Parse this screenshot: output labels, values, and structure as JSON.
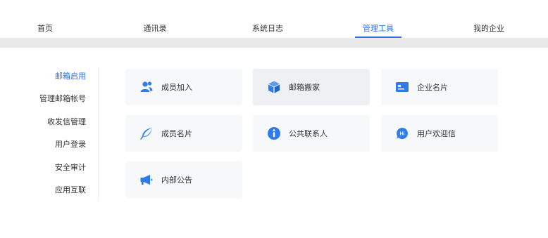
{
  "top_tabs": [
    {
      "label": "首页",
      "active": false
    },
    {
      "label": "通讯录",
      "active": false
    },
    {
      "label": "系统日志",
      "active": false
    },
    {
      "label": "管理工具",
      "active": true
    },
    {
      "label": "我的企业",
      "active": false
    }
  ],
  "side_menu": [
    {
      "label": "邮箱启用",
      "active": true
    },
    {
      "label": "管理邮箱帐号",
      "active": false
    },
    {
      "label": "收发信管理",
      "active": false
    },
    {
      "label": "用户登录",
      "active": false
    },
    {
      "label": "安全审计",
      "active": false
    },
    {
      "label": "应用互联",
      "active": false
    }
  ],
  "tools": [
    {
      "label": "成员加入",
      "icon": "add-member-icon"
    },
    {
      "label": "邮箱搬家",
      "icon": "box-icon"
    },
    {
      "label": "企业名片",
      "icon": "business-card-icon"
    },
    {
      "label": "成员名片",
      "icon": "feather-icon"
    },
    {
      "label": "公共联系人",
      "icon": "info-icon"
    },
    {
      "label": "用户欢迎信",
      "icon": "hi-chat-icon"
    },
    {
      "label": "内部公告",
      "icon": "megaphone-icon"
    }
  ],
  "colors": {
    "accent": "#2e6ee6",
    "icon": "#2f7be8",
    "card_bg": "#f7f8fa",
    "band": "#e9e9e9"
  }
}
